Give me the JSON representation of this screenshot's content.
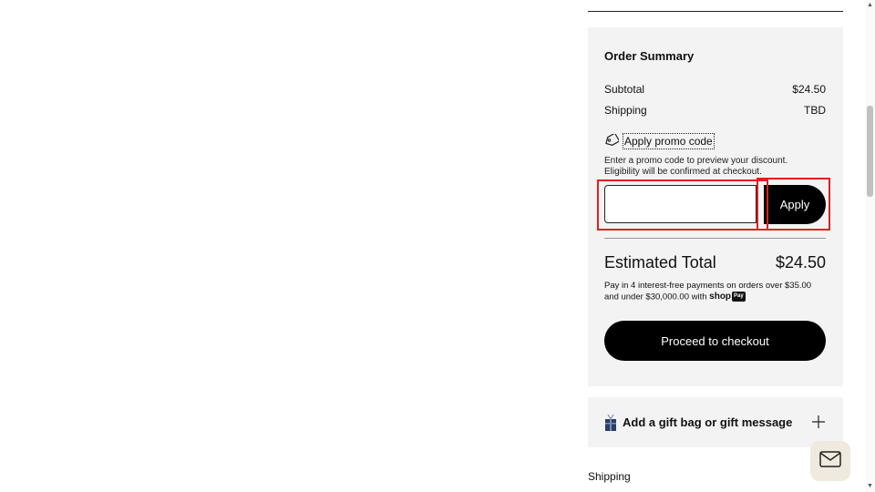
{
  "summary": {
    "title": "Order Summary",
    "subtotal_label": "Subtotal",
    "subtotal_value": "$24.50",
    "shipping_label": "Shipping",
    "shipping_value": "TBD"
  },
  "promo": {
    "toggle_label": "Apply promo code",
    "hint_line1": "Enter a promo code to preview your discount.",
    "hint_line2": "Eligibility will be confirmed at checkout.",
    "input_value": "",
    "apply_label": "Apply"
  },
  "total": {
    "label": "Estimated Total",
    "value": "$24.50",
    "pay_note_line1": "Pay in 4 interest-free payments on orders over $35.00",
    "pay_note_line2": "and under $30,000.00 with",
    "shop_brand": "shop",
    "shop_pay": "Pay"
  },
  "checkout": {
    "label": "Proceed to checkout"
  },
  "gift": {
    "label": "Add a gift bag or gift message"
  },
  "shipping_section": {
    "title": "Shipping"
  },
  "colors": {
    "accent": "#000000",
    "panel": "#f3f3f3",
    "highlight": "#e02020",
    "mail_button": "#efe9de"
  },
  "icons": [
    "tag-icon",
    "gift-icon",
    "plus-icon",
    "mail-icon"
  ]
}
